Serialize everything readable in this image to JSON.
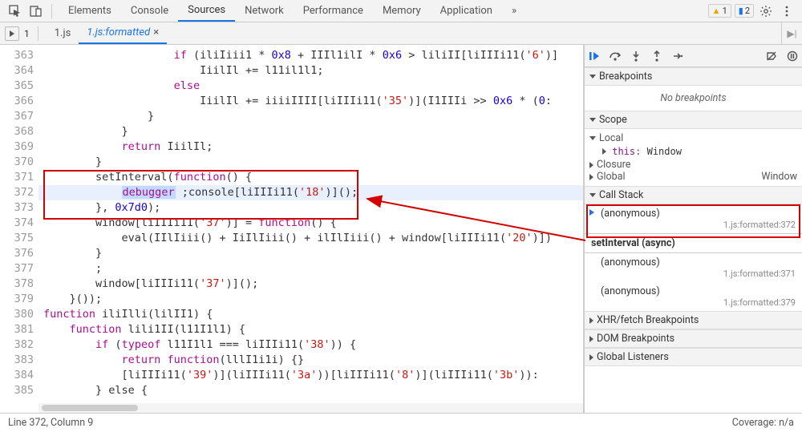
{
  "topbar": {
    "tabs": [
      "Elements",
      "Console",
      "Sources",
      "Network",
      "Performance",
      "Memory",
      "Application"
    ],
    "active_tab_index": 2,
    "warn_count": "1",
    "msg_count": "2"
  },
  "sub_bar": {
    "page_index": "1",
    "file_tabs": [
      {
        "label": "1.js"
      },
      {
        "label": "1.js:formatted"
      }
    ],
    "active_file_index": 1
  },
  "code": {
    "first_line_no": 363,
    "highlight_line_index": 9,
    "lines_html": [
      "                    <span class='tok-kw'>if</span> (iliIiii1 * <span class='tok-num'>0x8</span> + IIIl1ilI * <span class='tok-num'>0x6</span> &gt; liliII[liIIIi11(<span class='tok-str'>'6'</span>)]",
      "                        IiilIl += l11il1l1;",
      "                    <span class='tok-kw'>else</span>",
      "                        IiilIl += iiiiIIII[liIIIi11(<span class='tok-str'>'35'</span>)](I1IIIi &gt;&gt; <span class='tok-num'>0x6</span> * (<span class='tok-num'>0</span>:",
      "                }",
      "            }",
      "            <span class='tok-kw'>return</span> IiilIl;",
      "        }",
      "        setInterval(<span class='tok-kw'>function</span>() {",
      "            <span class='tok-dbg'>debugger</span> ;console[liIIIi11(<span class='tok-str'>'18'</span>)]();",
      "        }, <span class='tok-num'>0x7d0</span>);",
      "        window[liIIIi11(<span class='tok-str'>'37'</span>)] = <span class='tok-kw'>function</span>() {",
      "            eval(IIlIiii() + IiIlIiii() + ilIlIiii() + window[liIIIi11(<span class='tok-str'>'20'</span>)])",
      "        }",
      "        ;",
      "        window[liIIIi11(<span class='tok-str'>'37'</span>)]();",
      "    }());",
      "<span class='tok-kw'>function</span> iliIlli(lilII1) {",
      "    <span class='tok-kw'>function</span> lili1II(l11I1l1) {",
      "        <span class='tok-kw'>if</span> (<span class='tok-kw'>typeof</span> l11I1l1 === liIIIi11(<span class='tok-str'>'38'</span>)) {",
      "            <span class='tok-kw'>return</span> <span class='tok-kw'>function</span>(lllI1i1i) {}",
      "            [liIIIi11(<span class='tok-str'>'39'</span>)](liIIIi11(<span class='tok-str'>'3a'</span>))[liIIIi11(<span class='tok-str'>'8'</span>)](liIIIi11(<span class='tok-str'>'3b'</span>)):",
      "        } else {"
    ]
  },
  "sidebar": {
    "breakpoints_header": "Breakpoints",
    "no_breakpoints": "No breakpoints",
    "scope_header": "Scope",
    "scope": {
      "local_label": "Local",
      "this_key": "this",
      "this_val": "Window",
      "closure_label": "Closure",
      "global_label": "Global",
      "global_val": "Window"
    },
    "callstack_header": "Call Stack",
    "callstack": {
      "item0_name": "(anonymous)",
      "item0_loc": "1.js:formatted:372",
      "async_label": "setInterval (async)",
      "item1_name": "(anonymous)",
      "item1_loc": "1.js:formatted:371",
      "item2_name": "(anonymous)",
      "item2_loc": "1.js:formatted:379"
    },
    "xhr_header": "XHR/fetch Breakpoints",
    "dom_header": "DOM Breakpoints",
    "global_listeners_header": "Global Listeners"
  },
  "status_bar": {
    "left": "Line 372, Column 9",
    "right": "Coverage: n/a"
  }
}
